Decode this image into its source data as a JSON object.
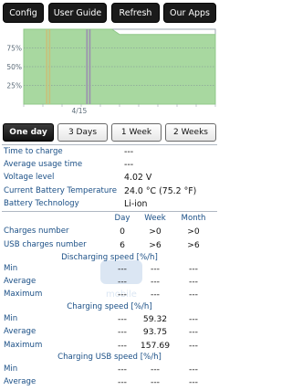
{
  "toolbar": {
    "config": "Config",
    "user_guide": "User Guide",
    "refresh": "Refresh",
    "our_apps": "Our Apps"
  },
  "chart_data": {
    "type": "area",
    "y_ticks": [
      "75%",
      "50%",
      "25%"
    ],
    "x_tick": "4/15",
    "ylim": [
      0,
      100
    ],
    "series": [
      {
        "values": [
          {
            "x": 0.0,
            "y": 100
          },
          {
            "x": 0.46,
            "y": 100
          },
          {
            "x": 0.5,
            "y": 93
          },
          {
            "x": 1.0,
            "y": 93
          }
        ]
      }
    ],
    "fill_color": "#a8d8a0",
    "charging_markers": [
      0.12,
      0.135,
      0.33,
      0.345
    ],
    "grid": true
  },
  "tabs": [
    "One day",
    "3 Days",
    "1 Week",
    "2 Weeks"
  ],
  "info": [
    {
      "label": "Time to charge",
      "value": "---"
    },
    {
      "label": "Average usage time",
      "value": "---"
    },
    {
      "label": "Voltage level",
      "value": "4.02 V"
    },
    {
      "label": "Current Battery Temperature",
      "value": "24.0 °C (75.2 °F)"
    },
    {
      "label": "Battery Technology",
      "value": "Li-ion"
    }
  ],
  "columns": {
    "day": "Day",
    "week": "Week",
    "month": "Month"
  },
  "charges": [
    {
      "label": "Charges number",
      "day": "0",
      "week": ">0",
      "month": ">0"
    },
    {
      "label": "USB charges number",
      "day": "6",
      "week": ">6",
      "month": ">6"
    }
  ],
  "sections": [
    {
      "title": "Discharging speed [%/h]",
      "rows": [
        {
          "label": "Min",
          "day": "---",
          "week": "---",
          "month": "---"
        },
        {
          "label": "Average",
          "day": "---",
          "week": "---",
          "month": "---"
        },
        {
          "label": "Maximum",
          "day": "---",
          "week": "---",
          "month": "---"
        }
      ]
    },
    {
      "title": "Charging speed [%/h]",
      "rows": [
        {
          "label": "Min",
          "day": "---",
          "week": "59.32",
          "month": "---"
        },
        {
          "label": "Average",
          "day": "---",
          "week": "93.75",
          "month": "---"
        },
        {
          "label": "Maximum",
          "day": "---",
          "week": "157.69",
          "month": "---"
        }
      ]
    },
    {
      "title": "Charging USB speed [%/h]",
      "rows": [
        {
          "label": "Min",
          "day": "---",
          "week": "---",
          "month": "---"
        },
        {
          "label": "Average",
          "day": "---",
          "week": "---",
          "month": "---"
        }
      ]
    }
  ],
  "watermark_text": "mobile"
}
